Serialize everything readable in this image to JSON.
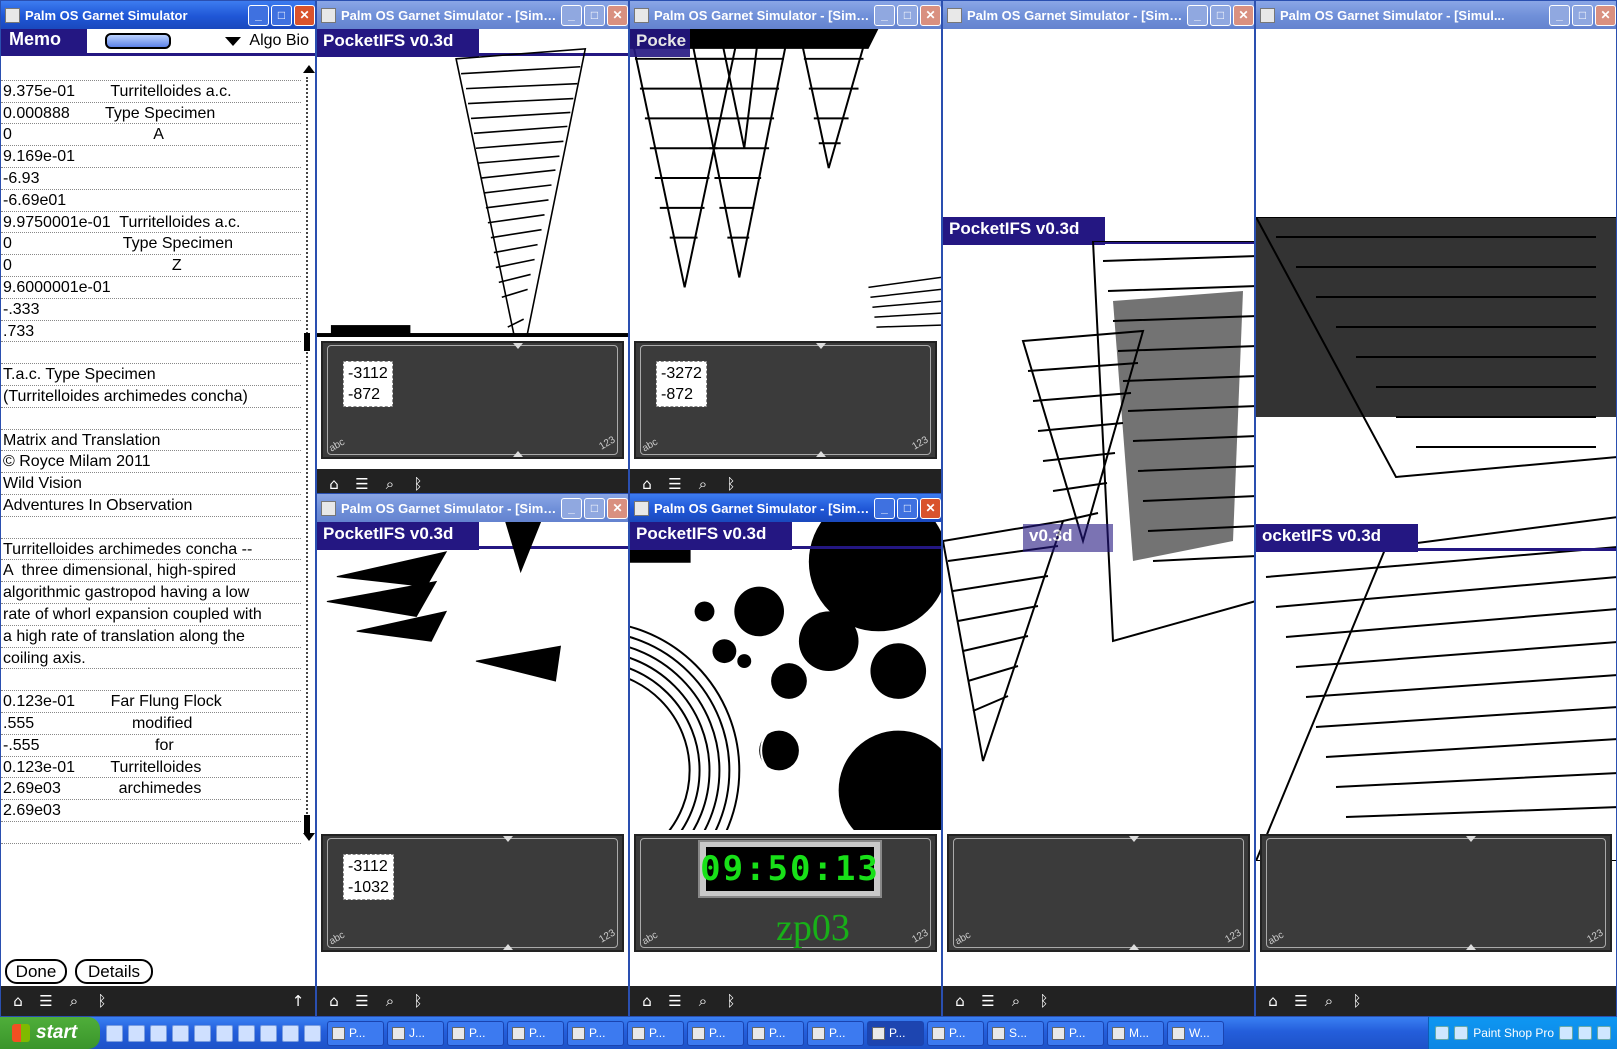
{
  "windows": {
    "memo_title": "Palm OS Garnet Simulator",
    "sim_title": "Palm OS Garnet Simulator - [Simul..."
  },
  "memo": {
    "app_label": "Memo",
    "category": "Algo Bio",
    "lines": [
      "",
      "9.375e-01        Turritelloides a.c.",
      "0.000888        Type Specimen",
      "0                                A",
      "9.169e-01",
      "-6.93",
      "-6.69e01",
      "9.9750001e-01  Turritelloides a.c.",
      "0                         Type Specimen",
      "0                                    Z",
      "9.6000001e-01",
      "-.333",
      ".733",
      "",
      "T.a.c. Type Specimen",
      "(Turritelloides archimedes concha)",
      "",
      "Matrix and Translation",
      "© Royce Milam 2011",
      "Wild Vision",
      "Adventures In Observation",
      "",
      "Turritelloides archimedes concha --",
      "A  three dimensional, high-spired",
      "algorithmic gastropod having a low",
      "rate of whorl expansion coupled with",
      "a high rate of translation along the",
      "coiling axis.",
      "",
      "0.123e-01        Far Flung Flock",
      ".555                      modified",
      "-.555                          for",
      "0.123e-01        Turritelloides",
      "2.69e03             archimedes",
      "2.69e03",
      ""
    ],
    "done_label": "Done",
    "details_label": "Details"
  },
  "pocketifs": {
    "title": "PocketIFS v0.3d",
    "title_partial_a": "Pocke",
    "title_partial_b": "ocketIFS v0.3d",
    "title_partial_c": "v0.3d",
    "coords": [
      {
        "x": "-3112",
        "y": "-872"
      },
      {
        "x": "-3272",
        "y": "-872"
      },
      {
        "x": "-3112",
        "y": "-1032"
      }
    ],
    "clock": "09:50:13",
    "graffiti_text": "zp03"
  },
  "graffiti": {
    "abc": "abc",
    "num": "123"
  },
  "taskbar": {
    "start_label": "start",
    "buttons": [
      "P...",
      "J...",
      "P...",
      "P...",
      "P...",
      "P...",
      "P...",
      "P...",
      "P...",
      "P...",
      "P...",
      "S...",
      "P...",
      "M...",
      "W..."
    ],
    "tray_app": "Paint Shop Pro"
  }
}
